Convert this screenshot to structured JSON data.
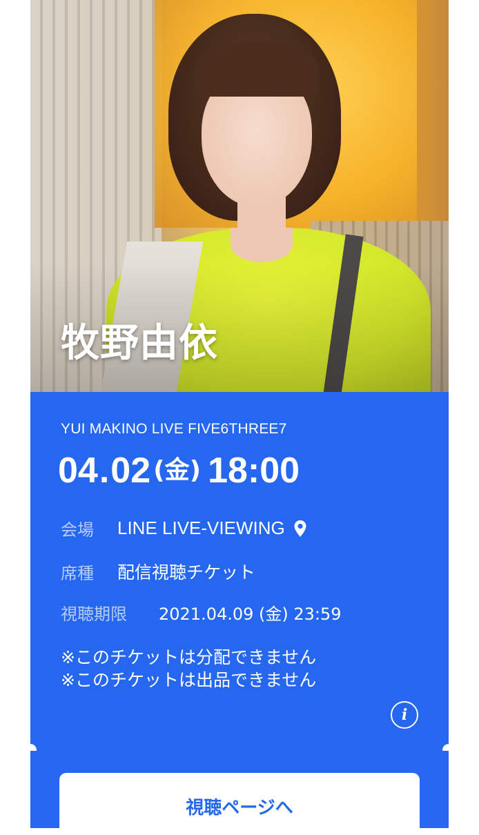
{
  "artist": {
    "name": "牧野由依"
  },
  "event": {
    "title": "YUI MAKINO LIVE FIVE6THREE7",
    "date_month": "04",
    "date_day": "02",
    "day_of_week": "(金)",
    "time": "18:00"
  },
  "details": {
    "venue_label": "会場",
    "venue_value": "LINE LIVE-VIEWING",
    "seat_label": "席種",
    "seat_value": "配信視聴チケット",
    "period_label": "視聴期限",
    "period_value": "2021.04.09 (金) 23:59"
  },
  "notes": [
    "※このチケットは分配できません",
    "※このチケットは出品できません"
  ],
  "info_icon": "info-icon",
  "location_icon": "map-pin-icon",
  "button": {
    "label": "視聴ページへ"
  },
  "colors": {
    "ticket_blue": "#2567ee",
    "label_blue": "#b7ccf8"
  }
}
